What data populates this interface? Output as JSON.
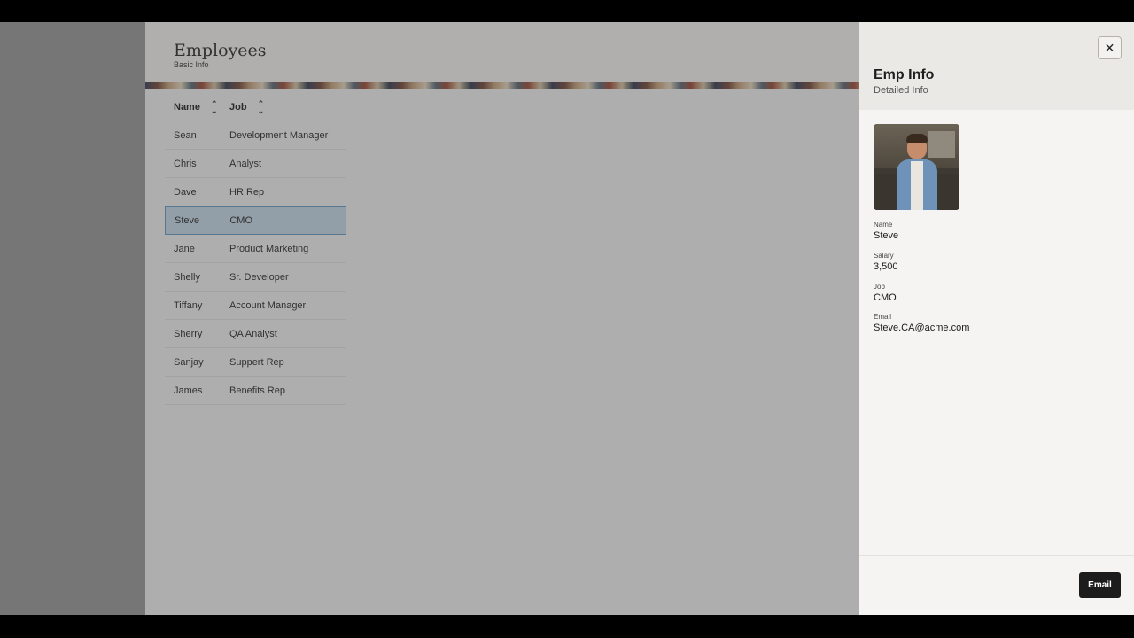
{
  "page": {
    "title": "Employees",
    "subtitle": "Basic Info"
  },
  "table": {
    "columns": [
      {
        "label": "Name",
        "sort_icon": "sort-icon"
      },
      {
        "label": "Job",
        "sort_icon": "sort-icon"
      }
    ],
    "rows": [
      {
        "name": "Sean",
        "job": "Development Manager",
        "selected": false
      },
      {
        "name": "Chris",
        "job": "Analyst",
        "selected": false
      },
      {
        "name": "Dave",
        "job": "HR Rep",
        "selected": false
      },
      {
        "name": "Steve",
        "job": "CMO",
        "selected": true
      },
      {
        "name": "Jane",
        "job": "Product Marketing",
        "selected": false
      },
      {
        "name": "Shelly",
        "job": "Sr. Developer",
        "selected": false
      },
      {
        "name": "Tiffany",
        "job": "Account Manager",
        "selected": false
      },
      {
        "name": "Sherry",
        "job": "QA Analyst",
        "selected": false
      },
      {
        "name": "Sanjay",
        "job": "Suppert Rep",
        "selected": false
      },
      {
        "name": "James",
        "job": "Benefits Rep",
        "selected": false
      }
    ]
  },
  "drawer": {
    "close_icon": "close-icon",
    "title": "Emp Info",
    "subtitle": "Detailed Info",
    "fields": [
      {
        "label": "Name",
        "value": "Steve"
      },
      {
        "label": "Salary",
        "value": "3,500"
      },
      {
        "label": "Job",
        "value": "CMO"
      },
      {
        "label": "Email",
        "value": "Steve.CA@acme.com"
      }
    ],
    "email_button": "Email"
  },
  "colors": {
    "selected_row": "#c9dcea",
    "selected_border": "#6a9cc4",
    "primary_button": "#1c1c1c"
  }
}
